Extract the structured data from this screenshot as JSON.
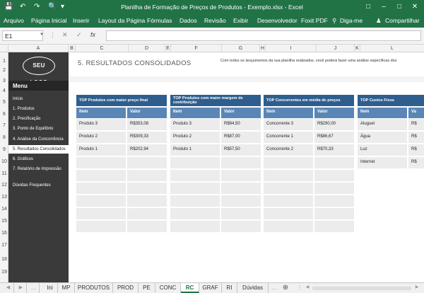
{
  "window": {
    "title": "Planilha de Formação de Preços de Produtos - Exemplo.xlsx - Excel"
  },
  "ribbon": {
    "tabs": [
      "Arquivo",
      "Página Inicial",
      "Inserir",
      "Layout da Página",
      "Fórmulas",
      "Dados",
      "Revisão",
      "Exibir",
      "Desenvolvedor",
      "Foxit PDF"
    ],
    "tell_me": "Diga-me",
    "share": "Compartilhar"
  },
  "formula_bar": {
    "name_box": "E1",
    "fx": "fx",
    "value": ""
  },
  "columns": [
    "A",
    "B",
    "C",
    "D",
    "E",
    "F",
    "G",
    "H",
    "I",
    "J",
    "K",
    "L"
  ],
  "rows": [
    "1",
    "2",
    "3",
    "4",
    "5",
    "6",
    "7",
    "8",
    "9",
    "10",
    "11",
    "12",
    "13",
    "14",
    "15",
    "16",
    "17",
    "18",
    "19"
  ],
  "sidebar": {
    "logo": "SEU LOGO",
    "menu_label": "Menu",
    "items": [
      "Início",
      "1. Produtos",
      "2. Precificação",
      "3. Ponto de Equilíbrio",
      "4. Análise da Concorrência",
      "5. Resultados Consolidados",
      "6. Gráficos",
      "7. Relatório de Impressão",
      "Dúvidas Frequentes"
    ]
  },
  "header": {
    "title": "5. RESULTADOS CONSOLIDADOS",
    "description": "Com todos os lançamentos da sua planilha realizados, você poderá fazer uma análise específicas dos"
  },
  "cards": [
    {
      "title": "TOP Produtos com maior preço final",
      "col_item": "Item",
      "col_value": "Valor",
      "rows": [
        [
          "Produto 3",
          "R$353,08"
        ],
        [
          "Produto 2",
          "R$309,33"
        ],
        [
          "Produto 1",
          "R$202,94"
        ]
      ]
    },
    {
      "title": "TOP Produtos com maior margem de contribuição",
      "col_item": "Item",
      "col_value": "Valor",
      "rows": [
        [
          "Produto 3",
          "R$94,50"
        ],
        [
          "Produto 2",
          "R$87,00"
        ],
        [
          "Produto 1",
          "R$57,50"
        ]
      ]
    },
    {
      "title": "TOP Concorrentes em média de preços",
      "col_item": "Item",
      "col_value": "Valor",
      "rows": [
        [
          "Concorrente 3",
          "R$290,00"
        ],
        [
          "Concorrente 1",
          "R$86,67"
        ],
        [
          "Concorrente 2",
          "R$70,33"
        ]
      ]
    },
    {
      "title": "TOP Custos Fixos",
      "col_item": "Item",
      "col_value": "Va",
      "rows": [
        [
          "Aluguel",
          "R$"
        ],
        [
          "Água",
          "R$"
        ],
        [
          "Luz",
          "R$"
        ],
        [
          "Internet",
          "R$"
        ]
      ]
    }
  ],
  "sheet_tabs": [
    "Ini",
    "MP",
    "PRODUTOS",
    "PROD",
    "PE",
    "CONC",
    "RC",
    "GRAF",
    "RI",
    "Dúvidas"
  ],
  "active_sheet": "RC",
  "colors": {
    "excel_green": "#217346",
    "card_title": "#2e5e8e",
    "card_header": "#5a86b6",
    "sidebar": "#3a3a3a"
  }
}
